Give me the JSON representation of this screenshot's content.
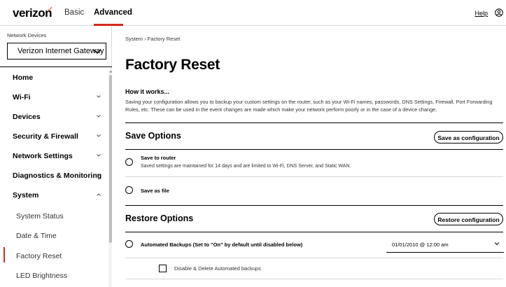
{
  "header": {
    "logo": "verizon",
    "logo_mark": "✓",
    "tabs": [
      "Basic",
      "Advanced"
    ],
    "help": "Help",
    "user_icon": "user-circle-icon",
    "accent_color": "#d52b1e"
  },
  "sidebar": {
    "device_label": "Network Devices",
    "device_selected": "Verizon Internet Gateway",
    "items": [
      {
        "label": "Home",
        "chevron": "none"
      },
      {
        "label": "Wi-Fi",
        "chevron": "down"
      },
      {
        "label": "Devices",
        "chevron": "down"
      },
      {
        "label": "Security & Firewall",
        "chevron": "down"
      },
      {
        "label": "Network Settings",
        "chevron": "down"
      },
      {
        "label": "Diagnostics & Monitoring",
        "chevron": "down"
      },
      {
        "label": "System",
        "chevron": "up"
      },
      {
        "label": "System Status",
        "sub": true
      },
      {
        "label": "Date & Time",
        "sub": true
      },
      {
        "label": "Factory Reset",
        "sub": true,
        "active": true
      },
      {
        "label": "LED Brightness",
        "sub": true
      }
    ]
  },
  "main": {
    "breadcrumb": "System  ›  Factory Reset",
    "title": "Factory Reset",
    "how_title": "How it works...",
    "how_text": "Saving your configuration allows you to backup your custom settings on the router, such as your Wi-Fi names, passwords, DNS Settings, Firewall, Port Forwarding Rules, etc. These can be used in the event changes are made which make your network perform poorly or in the case of a device change.",
    "save_options": {
      "title": "Save Options",
      "button": "Save as configuration",
      "router_title": "Save to router",
      "router_desc": "Saved settings are maintained for 14 days and are limited to Wi-Fi, DNS Server, and Static WAN.",
      "file_title": "Save as file"
    },
    "restore_options": {
      "title": "Restore Options",
      "button": "Restore configuration",
      "auto_title": "Automated Backups (Set to \"On\" by default until disabled below)",
      "auto_date": "01/01/2010 @ 12:00 am",
      "disable_label": "Disable & Delete Automated backups"
    }
  }
}
